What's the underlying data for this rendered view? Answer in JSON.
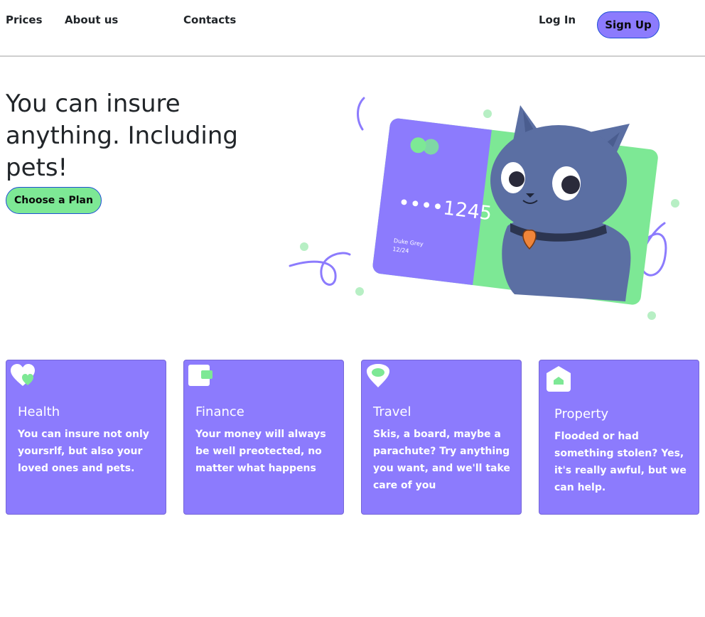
{
  "nav": {
    "prices": "Prices",
    "about": "About us",
    "contacts": "Contacts",
    "login": "Log In",
    "signup": "Sign Up"
  },
  "hero": {
    "title": "You can insure anything. Including pets!",
    "cta": "Choose a Plan",
    "card_number": "••••1245",
    "card_holder": "Duke Grey",
    "card_expiry": "12/24"
  },
  "features": [
    {
      "icon": "heart-icon",
      "title": "Health",
      "text": "You can insure not only yoursrlf, but also your loved ones and pets."
    },
    {
      "icon": "wallet-icon",
      "title": "Finance",
      "text": "Your money will always be well preotected, no matter what happens"
    },
    {
      "icon": "location-pin-icon",
      "title": "Travel",
      "text": "Skis, a board, maybe a parachute? Try anything you want, and we'll take care of you"
    },
    {
      "icon": "house-icon",
      "title": "Property",
      "text": "Flooded or had something stolen? Yes, it's really awful, but we can help."
    }
  ],
  "colors": {
    "accent_purple": "#8c7bfd",
    "accent_green": "#7de895",
    "text_dark": "#212529"
  }
}
